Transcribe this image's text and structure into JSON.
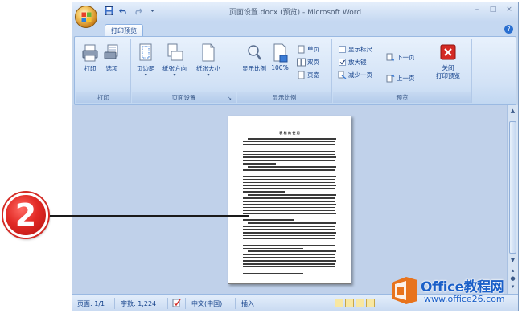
{
  "window": {
    "title": "页面设置.docx (预览) - Microsoft Word"
  },
  "tabs": [
    {
      "label": "打印预览",
      "active": true
    }
  ],
  "ribbon": {
    "groups": [
      {
        "label": "打印",
        "buttons": [
          "打印",
          "选项"
        ]
      },
      {
        "label": "页面设置",
        "buttons": [
          "页边距",
          "纸张方向",
          "纸张大小"
        ]
      },
      {
        "label": "显示比例",
        "buttons": [
          "显示比例",
          "100%"
        ],
        "small_buttons": [
          "单页",
          "双页",
          "页宽"
        ]
      },
      {
        "label": "预览",
        "checkboxes": [
          "显示标尺",
          "放大镜"
        ],
        "small_buttons": [
          "减少一页",
          "下一页",
          "上一页"
        ],
        "close_button": "关闭\n打印预览"
      }
    ]
  },
  "document": {
    "title": "表 格 的 使 用"
  },
  "statusbar": {
    "page": "页面: 1/1",
    "words": "字数: 1,224",
    "language": "中文(中国)",
    "mode": "插入"
  },
  "callout": {
    "number": "2"
  },
  "watermark": {
    "brand": "Office教程网",
    "url": "www.office26.com"
  },
  "colors": {
    "ribbon_bg": "#d2e2f6",
    "doc_bg": "#c0d1ea",
    "callout_red": "#e22b26",
    "close_red": "#d42a24",
    "accent_blue": "#15428b"
  }
}
